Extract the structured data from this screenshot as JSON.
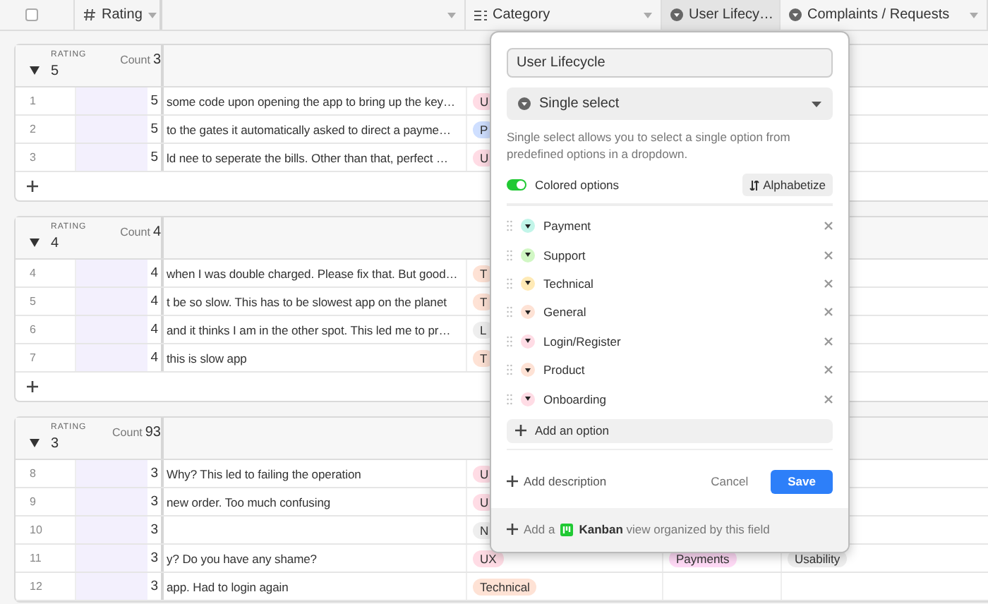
{
  "header": {
    "select_all_checked": false,
    "columns": [
      {
        "label": "Rating",
        "kind": "number",
        "selected": false
      },
      {
        "kind": "text",
        "selected": false
      },
      {
        "label": "Category",
        "kind": "multi",
        "selected": false
      },
      {
        "label": "User Lifecy…",
        "kind": "single",
        "selected": true
      },
      {
        "label": "Complaints / Requests",
        "kind": "single",
        "selected": false
      }
    ]
  },
  "groups": [
    {
      "label": "RATING",
      "value": "5",
      "count_label": "Count",
      "count": "3",
      "expanded": true,
      "add_row": true,
      "rows": [
        {
          "number": "1",
          "rating": "5",
          "text": "some code upon opening the app to bring up the key…",
          "category": {
            "label": "U",
            "color": "#ffdce5"
          }
        },
        {
          "number": "2",
          "rating": "5",
          "text": "to the gates it automatically asked to direct a payme…",
          "category": {
            "label": "P",
            "color": "#cfdfff"
          }
        },
        {
          "number": "3",
          "rating": "5",
          "text": "ld nee to seperate the bills. Other than that, perfect …",
          "category": {
            "label": "U",
            "color": "#ffdce5"
          }
        }
      ]
    },
    {
      "label": "RATING",
      "value": "4",
      "count_label": "Count",
      "count": "4",
      "expanded": true,
      "add_row": true,
      "rows": [
        {
          "number": "4",
          "rating": "4",
          "text": "when I was double charged. Please fix that. But good…",
          "category": {
            "label": "T",
            "color": "#fee2d5"
          }
        },
        {
          "number": "5",
          "rating": "4",
          "text": "t be so slow. This has to be slowest app on the planet",
          "category": {
            "label": "T",
            "color": "#fee2d5"
          }
        },
        {
          "number": "6",
          "rating": "4",
          "text": "and it thinks I am in the other spot. This led me to pr…",
          "category": {
            "label": "L",
            "color": "#eeeeee"
          }
        },
        {
          "number": "7",
          "rating": "4",
          "text": "this is slow app",
          "category": {
            "label": "T",
            "color": "#fee2d5"
          }
        }
      ]
    },
    {
      "label": "RATING",
      "value": "3",
      "count_label": "Count",
      "count": "93",
      "expanded": true,
      "rows": [
        {
          "number": "8",
          "rating": "3",
          "text": "Why? This led to failing the operation",
          "category": {
            "label": "U",
            "color": "#ffdce5"
          }
        },
        {
          "number": "9",
          "rating": "3",
          "text": "new order. Too much confusing",
          "category": {
            "label": "U",
            "color": "#ffdce5"
          }
        },
        {
          "number": "10",
          "rating": "3",
          "category": {
            "label": "N",
            "color": "#eeeeee"
          }
        },
        {
          "number": "11",
          "rating": "3",
          "text": "y? Do you have any shame?",
          "category": {
            "label": "UX",
            "color": "#ffdce5"
          },
          "lifecycle": {
            "label": "Payments",
            "color": "#ffdaf6"
          },
          "complaint": {
            "label": "Usability",
            "color": "#eeeeee"
          }
        },
        {
          "number": "12",
          "rating": "3",
          "text": "app. Had to login again",
          "category": {
            "label": "Technical",
            "color": "#fee2d5"
          }
        }
      ]
    }
  ],
  "field_editor": {
    "name_value": "User Lifecycle",
    "type_label": "Single select",
    "description": "Single select allows you to select a single option from predefined options in a dropdown.",
    "colored_toggle": {
      "label": "Colored options",
      "on": true
    },
    "sort_button": "Alphabetize",
    "options": [
      {
        "label": "Payment",
        "color": "#c2f5e9"
      },
      {
        "label": "Support",
        "color": "#d1f7c4"
      },
      {
        "label": "Technical",
        "color": "#ffeab6"
      },
      {
        "label": "General",
        "color": "#fee2d5"
      },
      {
        "label": "Login/Register",
        "color": "#ffdce5"
      },
      {
        "label": "Product",
        "color": "#fee2d5"
      },
      {
        "label": "Onboarding",
        "color": "#ffdce5"
      }
    ],
    "add_option": "Add an option",
    "add_description": "Add description",
    "cancel": "Cancel",
    "save": "Save",
    "footer_prefix": "Add a",
    "footer_text": "**Kanban** view organized by this field"
  }
}
